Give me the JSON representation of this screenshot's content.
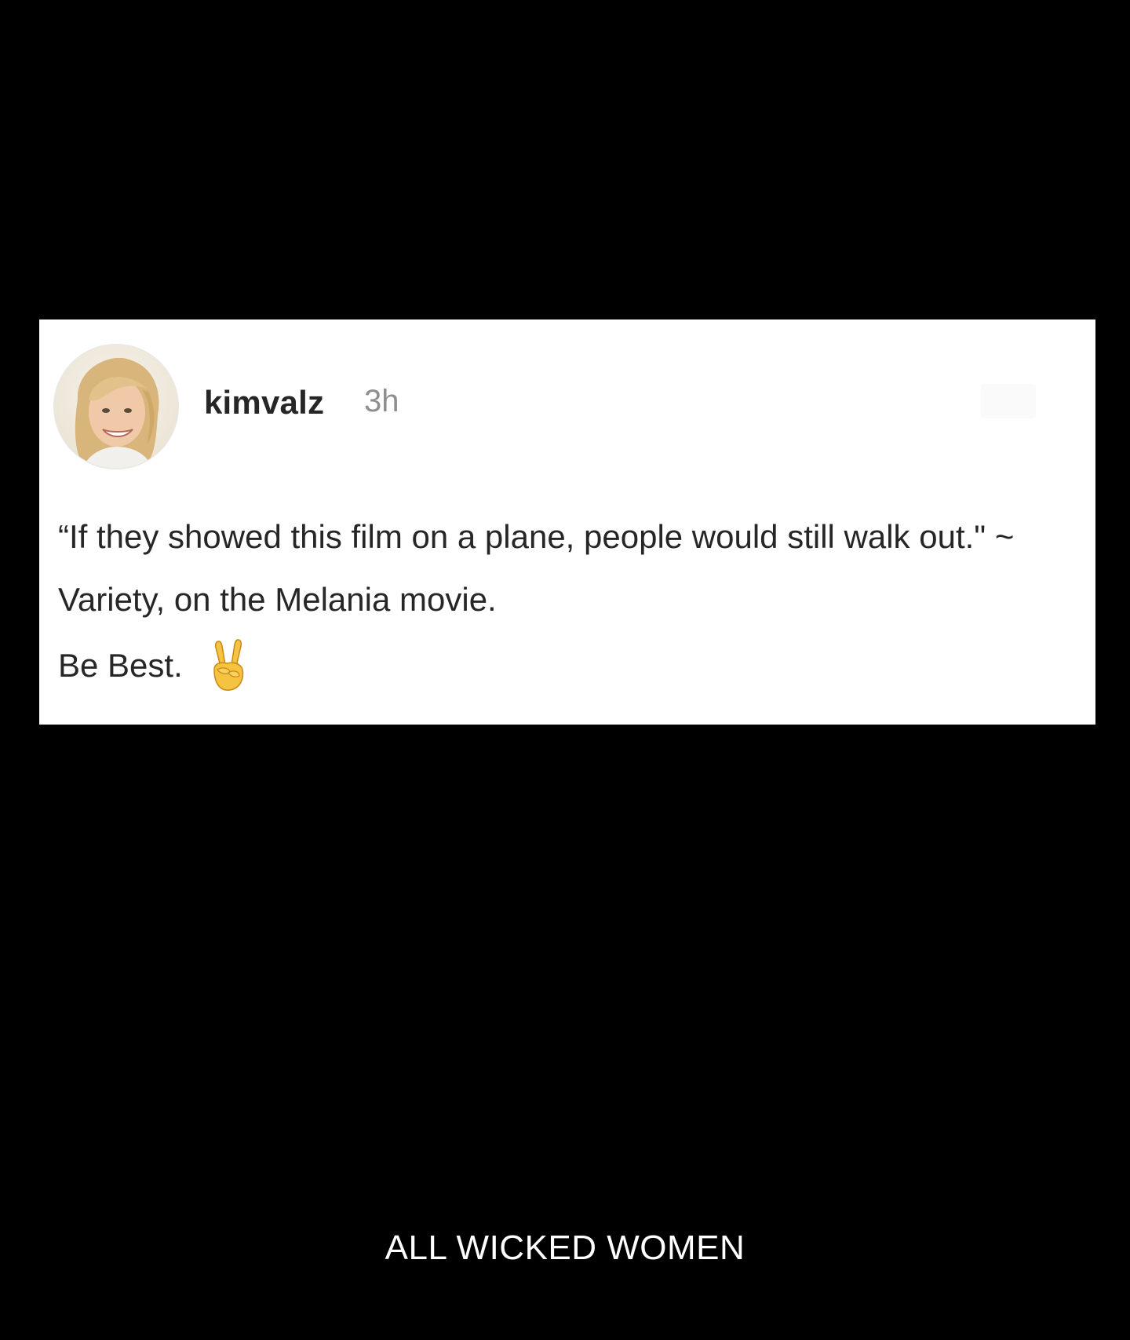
{
  "post": {
    "avatar_icon": "profile-photo",
    "username": "kimvalz",
    "timestamp": "3h",
    "body": "“If they showed this film on a plane, people would still walk out.\" ~ Variety, on the Melania movie.",
    "sign_off": "Be Best.",
    "sign_off_emoji": "victory-hand-icon"
  },
  "footer": {
    "brand": "ALL WICKED WOMEN"
  },
  "colors": {
    "background": "#000000",
    "card": "#ffffff",
    "text": "#262626",
    "muted": "#8e8e8e"
  }
}
